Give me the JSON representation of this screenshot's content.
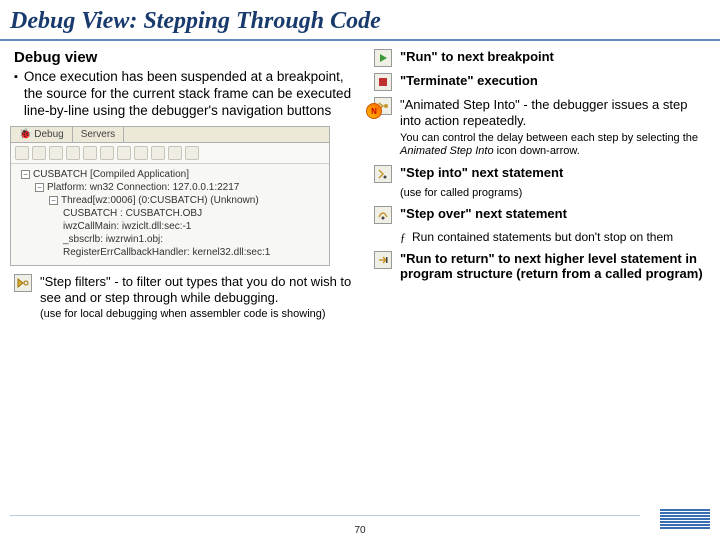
{
  "title": "Debug View: Stepping Through Code",
  "left": {
    "subhead": "Debug view",
    "bullet": "Once execution has been suspended at a breakpoint, the source for the current stack frame can be executed line-by-line using the debugger's navigation buttons",
    "step_filters": "\"Step filters\" - to filter out types that you do not wish  to see and or step through while debugging.",
    "step_filters_note": "(use for local debugging when assembler code is showing)"
  },
  "screenshot": {
    "tab1": "Debug",
    "tab2": "Servers",
    "root": "CUSBATCH [Compiled Application]",
    "platform": "Platform: wn32   Connection: 127.0.0.1:2217",
    "thread": "Thread[wz:0006] (0:CUSBATCH) (Unknown)",
    "l1": "CUSBATCH : CUSBATCH.OBJ",
    "l2": "iwzCallMain: iwziclt.dll:sec:-1",
    "l3": "_sbscrlb: iwzrwin1.obj:",
    "l4": "RegisterErrCallbackHandler: kernel32.dll:sec:1"
  },
  "right": {
    "run": "\"Run\" to next breakpoint",
    "terminate": "\"Terminate\" execution",
    "animated": "\"Animated Step Into\" -  the debugger issues a step into action repeatedly.",
    "animated_note": "You can control the delay between each step by selecting the Animated Step Into icon down-arrow.",
    "stepinto": "\"Step into\" next statement",
    "stepinto_note": "(use for called programs)",
    "stepover": "\"Step over\" next statement",
    "stepover_sub": "Run contained statements but don't stop on them",
    "runreturn": "\"Run to return\" to next higher level statement in program structure (return from a called program)"
  },
  "page": "70"
}
